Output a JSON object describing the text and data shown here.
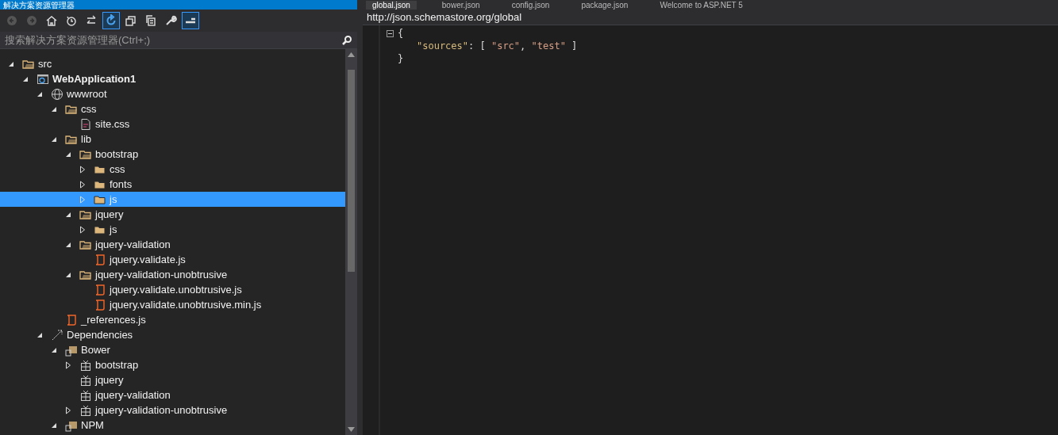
{
  "solution_explorer": {
    "title": "解决方案资源管理器",
    "toolbar": [
      {
        "kind": "back",
        "disabled": true,
        "selected": false
      },
      {
        "kind": "forward",
        "disabled": true,
        "selected": false
      },
      {
        "kind": "home",
        "disabled": false,
        "selected": false
      },
      {
        "kind": "history",
        "disabled": false,
        "selected": false
      },
      {
        "kind": "sync",
        "disabled": false,
        "selected": false
      },
      {
        "kind": "refresh",
        "disabled": false,
        "selected": true
      },
      {
        "kind": "collapse",
        "disabled": false,
        "selected": false
      },
      {
        "kind": "copy",
        "disabled": false,
        "selected": false
      },
      {
        "kind": "properties",
        "disabled": false,
        "selected": false
      },
      {
        "kind": "preview",
        "disabled": false,
        "selected": true
      }
    ],
    "search": {
      "placeholder": "搜索解决方案资源管理器(Ctrl+;)"
    },
    "tree": [
      {
        "label": "src",
        "kind": "folder-open",
        "expanded": true,
        "selected": false,
        "children": [
          {
            "label": "WebApplication1",
            "kind": "project",
            "bold": true,
            "expanded": true,
            "selected": false,
            "children": [
              {
                "label": "wwwroot",
                "kind": "globe",
                "expanded": true,
                "selected": false,
                "children": [
                  {
                    "label": "css",
                    "kind": "folder-open",
                    "expanded": true,
                    "selected": false,
                    "children": [
                      {
                        "label": "site.css",
                        "kind": "css-file",
                        "selected": false
                      }
                    ]
                  },
                  {
                    "label": "lib",
                    "kind": "folder-open",
                    "expanded": true,
                    "selected": false,
                    "children": [
                      {
                        "label": "bootstrap",
                        "kind": "folder-open",
                        "expanded": true,
                        "selected": false,
                        "children": [
                          {
                            "label": "css",
                            "kind": "folder",
                            "expanded": false,
                            "selected": false
                          },
                          {
                            "label": "fonts",
                            "kind": "folder",
                            "expanded": false,
                            "selected": false
                          },
                          {
                            "label": "js",
                            "kind": "folder",
                            "expanded": false,
                            "selected": true
                          }
                        ]
                      },
                      {
                        "label": "jquery",
                        "kind": "folder-open",
                        "expanded": true,
                        "selected": false,
                        "children": [
                          {
                            "label": "js",
                            "kind": "folder",
                            "expanded": false,
                            "selected": false
                          }
                        ]
                      },
                      {
                        "label": "jquery-validation",
                        "kind": "folder-open",
                        "expanded": true,
                        "selected": false,
                        "children": [
                          {
                            "label": "jquery.validate.js",
                            "kind": "js-file",
                            "selected": false
                          }
                        ]
                      },
                      {
                        "label": "jquery-validation-unobtrusive",
                        "kind": "folder-open",
                        "expanded": true,
                        "selected": false,
                        "children": [
                          {
                            "label": "jquery.validate.unobtrusive.js",
                            "kind": "js-file",
                            "selected": false
                          },
                          {
                            "label": "jquery.validate.unobtrusive.min.js",
                            "kind": "js-file",
                            "selected": false
                          }
                        ]
                      }
                    ]
                  },
                  {
                    "label": "_references.js",
                    "kind": "js-file",
                    "selected": false
                  }
                ]
              },
              {
                "label": "Dependencies",
                "kind": "dependencies",
                "expanded": true,
                "selected": false,
                "children": [
                  {
                    "label": "Bower",
                    "kind": "package-source",
                    "expanded": true,
                    "selected": false,
                    "children": [
                      {
                        "label": "bootstrap",
                        "kind": "package",
                        "expanded": false,
                        "selected": false
                      },
                      {
                        "label": "jquery",
                        "kind": "package",
                        "selected": false
                      },
                      {
                        "label": "jquery-validation",
                        "kind": "package",
                        "selected": false
                      },
                      {
                        "label": "jquery-validation-unobtrusive",
                        "kind": "package",
                        "expanded": false,
                        "selected": false
                      }
                    ]
                  },
                  {
                    "label": "NPM",
                    "kind": "package-source",
                    "expanded": true,
                    "selected": false
                  }
                ]
              }
            ]
          }
        ]
      }
    ]
  },
  "editor": {
    "tabs": [
      {
        "label": "global.json",
        "selected": true
      },
      {
        "label": "bower.json",
        "selected": false
      },
      {
        "label": "config.json",
        "selected": false
      },
      {
        "label": "package.json",
        "selected": false
      },
      {
        "label": "Welcome to ASP.NET 5",
        "selected": false
      }
    ],
    "schema_url": "http://json.schemastore.org/global",
    "lines": [
      [
        {
          "kind": "punct",
          "text": "{"
        }
      ],
      [
        {
          "kind": "key",
          "text": "\"sources\""
        },
        {
          "kind": "punct",
          "text": ": [ "
        },
        {
          "kind": "string",
          "text": "\"src\""
        },
        {
          "kind": "punct",
          "text": ", "
        },
        {
          "kind": "string",
          "text": "\"test\""
        },
        {
          "kind": "punct",
          "text": " ]"
        }
      ],
      [
        {
          "kind": "punct",
          "text": "}"
        }
      ]
    ]
  }
}
